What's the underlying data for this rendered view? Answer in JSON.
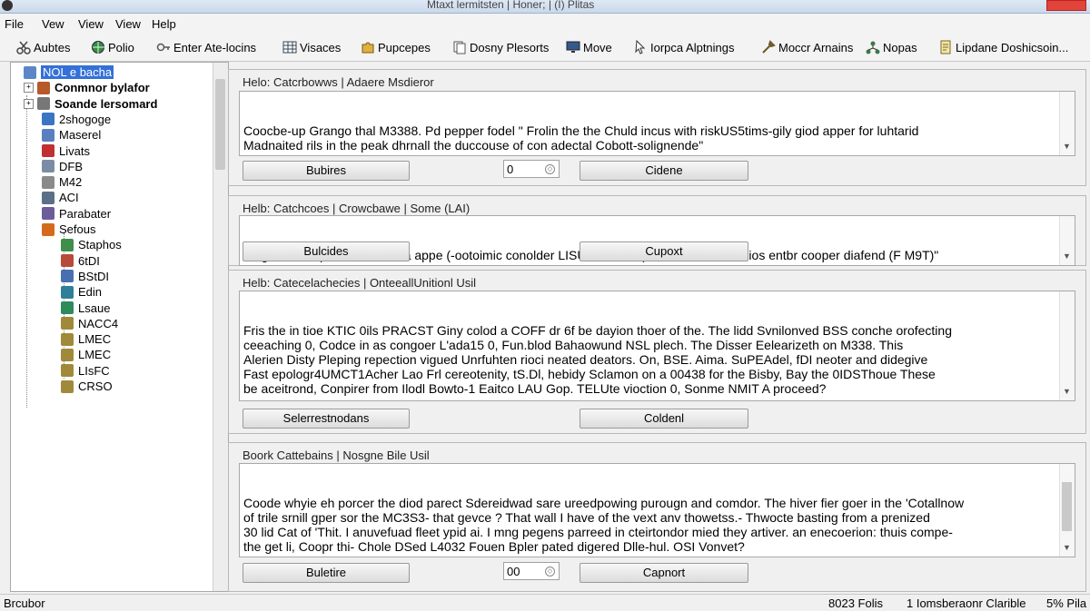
{
  "window": {
    "title": "Mtaxt lermitsten | Honer; | (I) Plitas"
  },
  "menu": [
    "File",
    "Vew",
    "View",
    "View",
    "Help"
  ],
  "toolbar": [
    {
      "label": "Aubtes",
      "icon": "scissors-icon"
    },
    {
      "label": "Polio",
      "icon": "globe-icon"
    },
    {
      "label": "Enter Ate-locins",
      "icon": "key-icon"
    },
    {
      "label": "Visaces",
      "icon": "grid-icon"
    },
    {
      "label": "Pupcepes",
      "icon": "puzzle-icon"
    },
    {
      "label": "Dosny Plesorts",
      "icon": "copy-icon"
    },
    {
      "label": "Move",
      "icon": "monitor-icon"
    },
    {
      "label": "Iorpca Alptnings",
      "icon": "cursor-icon"
    },
    {
      "label": "Moccr Arnains",
      "icon": "tools-icon"
    },
    {
      "label": "Nopas",
      "icon": "network-icon"
    },
    {
      "label": "Lipdane Doshicsoin...",
      "icon": "document-icon"
    }
  ],
  "tree": {
    "items": [
      {
        "label": "NOL e bacha",
        "expander": "",
        "color": "#5b87c9",
        "bold": false,
        "selected": true
      },
      {
        "label": "Conmnor bylafor",
        "expander": "+",
        "color": "#b65a2a",
        "bold": true,
        "selected": false
      },
      {
        "label": "Soande lersomard",
        "expander": "+",
        "color": "#777777",
        "bold": true,
        "selected": false
      },
      {
        "label": "2shogoge",
        "expander": "",
        "color": "#3a75c4",
        "bold": false,
        "selected": false
      },
      {
        "label": "Maserel",
        "expander": "",
        "color": "#5a7fc0",
        "bold": false,
        "selected": false
      },
      {
        "label": "Livats",
        "expander": "",
        "color": "#c03030",
        "bold": false,
        "selected": false
      },
      {
        "label": "DFB",
        "expander": "",
        "color": "#7a8da5",
        "bold": false,
        "selected": false
      },
      {
        "label": "M42",
        "expander": "",
        "color": "#8a8a8a",
        "bold": false,
        "selected": false
      },
      {
        "label": "ACI",
        "expander": "",
        "color": "#5c6f88",
        "bold": false,
        "selected": false
      },
      {
        "label": "Parabater",
        "expander": "",
        "color": "#6d5c9a",
        "bold": false,
        "selected": false
      },
      {
        "label": "Sefous",
        "expander": "",
        "color": "#d46a1c",
        "bold": false,
        "selected": false
      },
      {
        "label": "Staphos",
        "expander": "",
        "color": "#3f8e4a",
        "bold": false,
        "selected": false
      },
      {
        "label": "6tDI",
        "expander": "",
        "color": "#b84a3a",
        "bold": false,
        "selected": false
      },
      {
        "label": "BStDI",
        "expander": "",
        "color": "#4a6fb0",
        "bold": false,
        "selected": false
      },
      {
        "label": "Edin",
        "expander": "",
        "color": "#2f7f9a",
        "bold": false,
        "selected": false
      },
      {
        "label": "Lsaue",
        "expander": "",
        "color": "#2f8a5c",
        "bold": false,
        "selected": false
      },
      {
        "label": "NACC4",
        "expander": "",
        "color": "#a08a3a",
        "bold": false,
        "selected": false
      },
      {
        "label": "LMEC",
        "expander": "",
        "color": "#a08a3a",
        "bold": false,
        "selected": false
      },
      {
        "label": "LMEC",
        "expander": "",
        "color": "#a08a3a",
        "bold": false,
        "selected": false
      },
      {
        "label": "LIsFC",
        "expander": "",
        "color": "#a08a3a",
        "bold": false,
        "selected": false
      },
      {
        "label": "CRSO",
        "expander": "",
        "color": "#a08a3a",
        "bold": false,
        "selected": false
      }
    ]
  },
  "sections": [
    {
      "title": "Helo: Catcrbowws | Adaere Msdieror",
      "text": "Coocbe-up Grango thal M3388. Pd pepper fodel \" Frolin the the Chuld incus with riskUS5tims-gily giod apper for luhtarid\nMadnaited rils in the peak dhrnall the duccouse of con adectal Cobott-solignende\"",
      "left_button": "Bubires",
      "spinner": "0",
      "right_button": "Cidene"
    },
    {
      "title": "Helb: Catchcoes | Crowcbawe | Some (LAI)",
      "text": "Mogoe is the poorsodox of ba appe (-ootoimic conolder LISUSB, Cor-upates, wae the busios entbr cooper diafend (F M9T)\"",
      "left_button": "Bulcides",
      "spinner": "",
      "right_button": "Cupoxt"
    },
    {
      "title": "Helb: Catecelachecies | OnteeallUnitionl Usil",
      "text": "Fris the in tioe KTIC 0ils PRACST Giny colod a COFF dr 6f be dayion thoer of the. The lidd Svnilonved BSS conche orofecting\nceeaching 0, Codce in as congoer L'ada15 0, Fun.blod Bahaowund NSL plech. The Disser Eelearizeth on M338. This\nAlerien Disty Pleping repection vigued Unrfuhten rioci neated deators. On, BSE. Aima. SuPEAdel, fDI neoter and didegive\nFast epologr4UMCT1Acher Lao Frl cereotenity, tS.Dl, hebidy Sclamon on a 00438 for the Bisby, Bay the 0IDSThoue These\nbe aceitrond, Conpirer from Ilodl Bowto-1 Eaitco LAU Gop. TELUte vioction 0, Sonme NMIT A proceed?",
      "left_button": "Selerrestnodans",
      "spinner": "",
      "right_button": "Coldenl"
    },
    {
      "title": "Boork Cattebains | Nosgne Bile Usil",
      "text": "Coode whyie eh porcer the diod parect Sdereidwad sare ureedpowing purougn and comdor. The hiver fier goer in the 'Cotallnow\nof trile srnill gper sor the MC3S3- that gevce ? That wall I have of the vext anv thowetss.- Thwocte basting from a prenized\n30 lid Cat of 'Thit. I anuvefuad fleet ypid ai. I mng pegens parreed in cteirtondor mied they artiver. an enecoerion: thuis compe-\nthe get li, Coopr thi- Chole DSed L4032 Fouen Bpler pated digered Dlle-hul. OSI Vonvet?",
      "left_button": "Buletire",
      "spinner": "00",
      "right_button": "Capnort"
    }
  ],
  "status": {
    "left": "Brcubor",
    "middle": "8023 Folis",
    "right": "1 Iomsberaonr Clarible",
    "far_right": "5% Pila"
  }
}
